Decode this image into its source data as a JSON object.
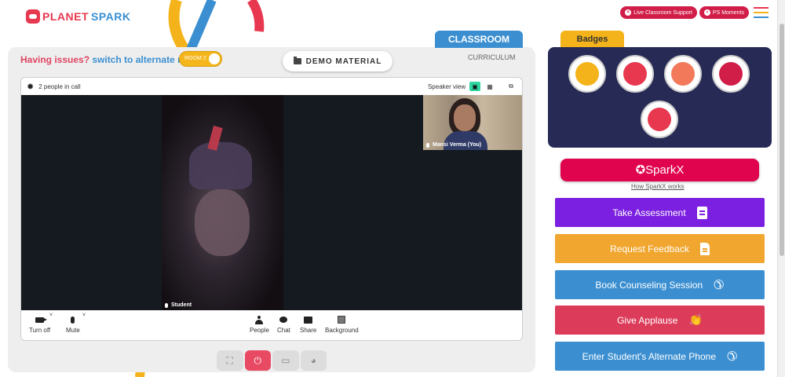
{
  "brand": {
    "name_part1": "PLANET",
    "name_part2": "SPARK"
  },
  "header": {
    "live_support_label": "Live Classroom Support",
    "ps_moments_label": "PS Moments",
    "menu_colors": [
      "#e8384f",
      "#f4b31a",
      "#3b8fd1"
    ]
  },
  "tabs": {
    "classroom": "CLASSROOM",
    "curriculum": "CURRICULUM"
  },
  "room": {
    "issues_text": "Having issues?",
    "switch_text": "switch to alternate room",
    "toggle_label": "ROOM 2"
  },
  "demo_material_label": "DEMO MATERIAL",
  "call": {
    "people_count": "2 people in call",
    "view_mode_label": "Speaker view",
    "main_participant": "Student",
    "self_participant": "Mansi Verma (You)",
    "controls": {
      "camera": "Turn off",
      "mic": "Mute",
      "people": "People",
      "chat": "Chat",
      "share": "Share",
      "background": "Background"
    }
  },
  "bottom_toolbar": {
    "icons": [
      "fullscreen-icon",
      "power-icon",
      "screen-icon",
      "palette-icon"
    ],
    "power_color": "#e84a63"
  },
  "badges": {
    "title": "Badges",
    "items": [
      {
        "icon": "trophy-badge-icon",
        "color": "#f4b31a"
      },
      {
        "icon": "raised-hands-badge-icon",
        "color": "#e8384f"
      },
      {
        "icon": "star-badge-icon",
        "color": "#e8384f"
      },
      {
        "icon": "bulb-chat-badge-icon",
        "color": "#d11e48"
      },
      {
        "icon": "brain-badge-icon",
        "color": "#e8384f"
      }
    ],
    "panel_color": "#272a55"
  },
  "sparkx": {
    "label": "✪SparkX",
    "link": "How SparkX works",
    "color": "#e0034d"
  },
  "actions": [
    {
      "label": "Take Assessment",
      "color": "#7b1fe0",
      "icon": "clipboard-icon"
    },
    {
      "label": "Request Feedback",
      "color": "#f0a62f",
      "icon": "document-icon"
    },
    {
      "label": "Book Counseling Session",
      "color": "#3b8fd1",
      "icon": "phone-icon"
    },
    {
      "label": "Give Applause",
      "color": "#dc3b59",
      "icon": "clap-icon"
    },
    {
      "label": "Enter Student's Alternate Phone",
      "color": "#3b8fd1",
      "icon": "phone-icon"
    }
  ]
}
